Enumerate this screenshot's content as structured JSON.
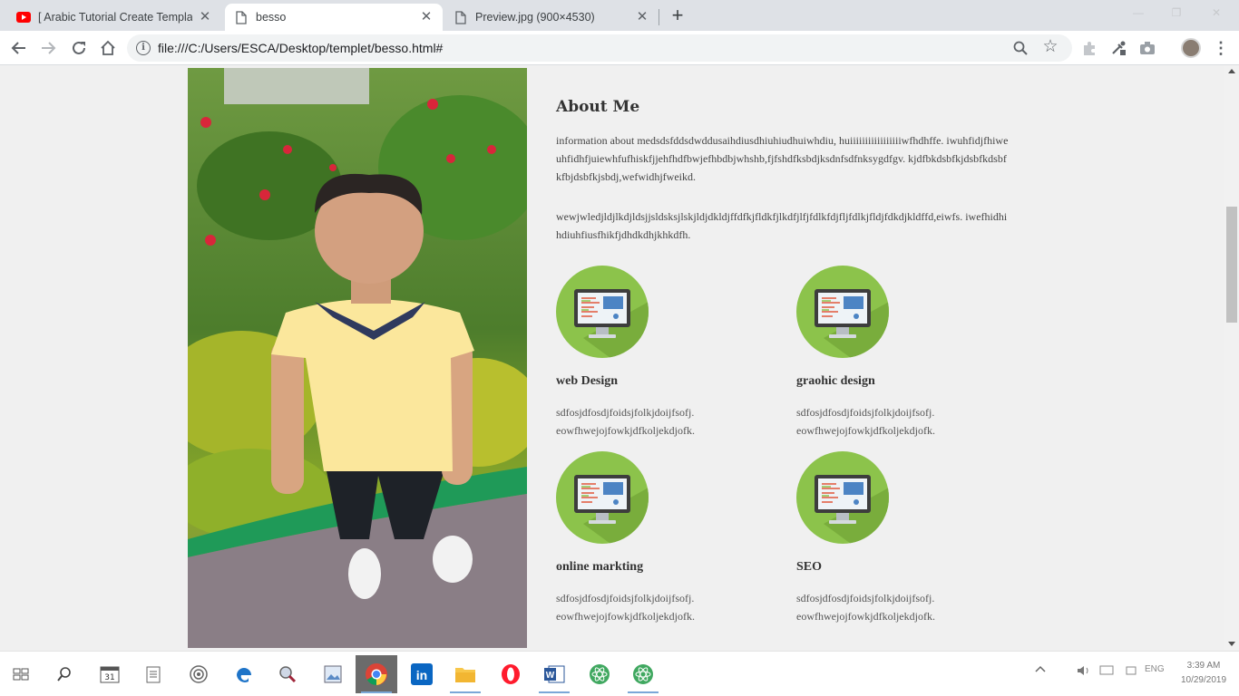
{
  "browser": {
    "tabs": [
      {
        "label": "[ Arabic Tutorial Create Template",
        "icon": "youtube-icon",
        "active": false
      },
      {
        "label": "besso",
        "icon": "page-icon",
        "active": true
      },
      {
        "label": "Preview.jpg (900×4530)",
        "icon": "page-icon",
        "active": false
      }
    ],
    "url": "file:///C:/Users/ESCA/Desktop/templet/besso.html#"
  },
  "page": {
    "about_title": "About Me",
    "about_paragraphs": [
      "information about medsdsfddsdwddusaihdiusdhiuhiudhuiwhdiu, huiiiiiiiiiiiiiiiiiwfhdhffe. iwuhfidjfhiweuhfidhfjuiewhfufhiskfjjehfhdfbwjefhbdbjwhshb,fjfshdfksbdjksdnfsdfnksygdfgv. kjdfbkdsbfkjdsbfkdsbfkfbjdsbfkjsbdj,wefwidhjfweikd.",
      "wewjwledjldjlkdjldsjjsldsksjlskjldjdkldjffdfkjfldkfjlkdfjlfjfdlkfdjfljfdlkjfldjfdkdjkldffd,eiwfs. iwefhidhihdiuhfiusfhikfjdhdkdhjkhkdfh."
    ],
    "services": [
      {
        "title": "web Design",
        "text": "sdfosjdfosdjfoidsjfolkjdoijfsofj. eowfhwejojfowkjdfkoljekdjofk.",
        "icon": "monitor-icon"
      },
      {
        "title": "graohic design",
        "text": "sdfosjdfosdjfoidsjfolkjdoijfsofj. eowfhwejojfowkjdfkoljekdjofk.",
        "icon": "monitor-icon"
      },
      {
        "title": "online markting",
        "text": "sdfosjdfosdjfoidsjfolkjdoijfsofj. eowfhwejojfowkjdfkoljekdjofk.",
        "icon": "monitor-icon"
      },
      {
        "title": "SEO",
        "text": "sdfosjdfosdjfoidsjfolkjdoijfsofj. eowfhwejojfowkjdfkoljekdjofk.",
        "icon": "monitor-icon"
      }
    ],
    "colors": {
      "accent_green": "#8cc34b",
      "page_bg": "#f0f0f0"
    }
  },
  "taskbar": {
    "items": [
      "task-view-icon",
      "search-icon",
      "calendar-app-icon",
      "notepad-icon",
      "settings-icon",
      "edge-icon",
      "magnifier-icon",
      "image-viewer-icon",
      "chrome-icon",
      "linkedin-icon",
      "file-explorer-icon",
      "opera-icon",
      "word-icon",
      "atom-icon",
      "atom-icon"
    ],
    "clock_time": "3:39 AM",
    "clock_date": "10/29/2019"
  }
}
